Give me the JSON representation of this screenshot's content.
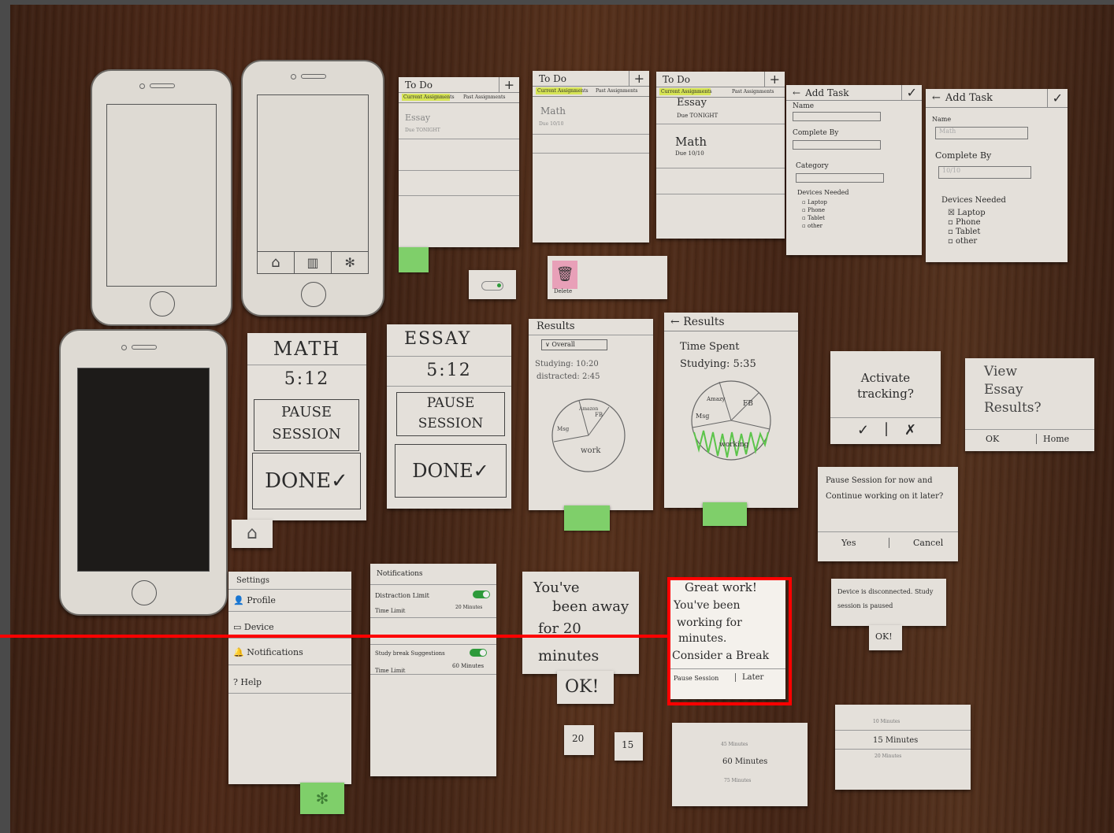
{
  "todo": {
    "title": "To Do",
    "plus": "+",
    "tab_current": "Current Assignments",
    "tab_past": "Past Assignments",
    "item1_name": "Essay",
    "item1_due": "Due TONIGHT",
    "item2_name": "Math",
    "item2_due": "Due 10/10"
  },
  "small_notes": {
    "delete": "Delete",
    "num_20": "20",
    "num_15": "15"
  },
  "add_task": {
    "title": "Add Task",
    "check": "✓",
    "back": "←",
    "name": "Name",
    "name_value": "Math",
    "complete_by": "Complete By",
    "complete_by_value": "10/10",
    "category": "Category",
    "devices_needed": "Devices Needed",
    "devices": [
      "Laptop",
      "Phone",
      "Tablet",
      "other"
    ]
  },
  "session_math": {
    "subject": "MATH",
    "time": "5:12",
    "pause": "PAUSE SESSION",
    "done": "DONE✓"
  },
  "session_essay": {
    "subject": "ESSAY",
    "time": "5:12",
    "pause": "PAUSE SESSION",
    "done": "DONE✓"
  },
  "results1": {
    "title": "Results",
    "dropdown": "Overall",
    "studying": "Studying: 10:20",
    "distracted": "distracted: 2:45",
    "slice_work": "work",
    "slice_msg": "Msg",
    "slice_fb": "FB",
    "slice_other": "Amazon"
  },
  "results2": {
    "title": "Results",
    "time_spent": "Time Spent",
    "studying": "Studying: 5:35",
    "slice_work": "working",
    "slice_msg": "Msg",
    "slice_fb": "FB",
    "slice_other": "Amazy"
  },
  "dialogs": {
    "activate": "Activate tracking?",
    "activate_yes": "✓",
    "activate_no": "✗",
    "view_results": "View Essay Results?",
    "view_ok": "OK",
    "view_home": "Home",
    "pause_prompt": "Pause Session for now and Continue working on it later?",
    "pause_yes": "Yes",
    "pause_cancel": "Cancel",
    "disconnected": "Device is disconnected. Study session is paused",
    "disconnected_ok": "OK!",
    "away_line1": "You've",
    "away_line2": "been away",
    "away_line3": "for 20",
    "away_line4": "minutes",
    "away_ok": "OK!",
    "break_line1": "Great work!",
    "break_line2": "You've been",
    "break_line3": "working for",
    "break_line4": "minutes.",
    "break_line5": "Consider a Break",
    "break_pause": "Pause Session",
    "break_later": "Later"
  },
  "settings": {
    "title": "Settings",
    "items": [
      "Profile",
      "Device",
      "Notifications",
      "Help"
    ]
  },
  "notifications": {
    "title": "Notifications",
    "distraction_limit": "Distraction Limit",
    "time_limit": "Time Limit",
    "distraction_value": "20 Minutes",
    "study_break": "Study break Suggestions",
    "study_value": "60 Minutes"
  },
  "pickers": {
    "picker1": [
      "45 Minutes",
      "60 Minutes",
      "75 Minutes"
    ],
    "picker2": [
      "10 Minutes",
      "15 Minutes",
      "20 Minutes"
    ]
  },
  "colors": {
    "highlight_box": "#ff0000",
    "accent_green": "#7fcf6a",
    "accent_pink": "#e8a0b8"
  }
}
